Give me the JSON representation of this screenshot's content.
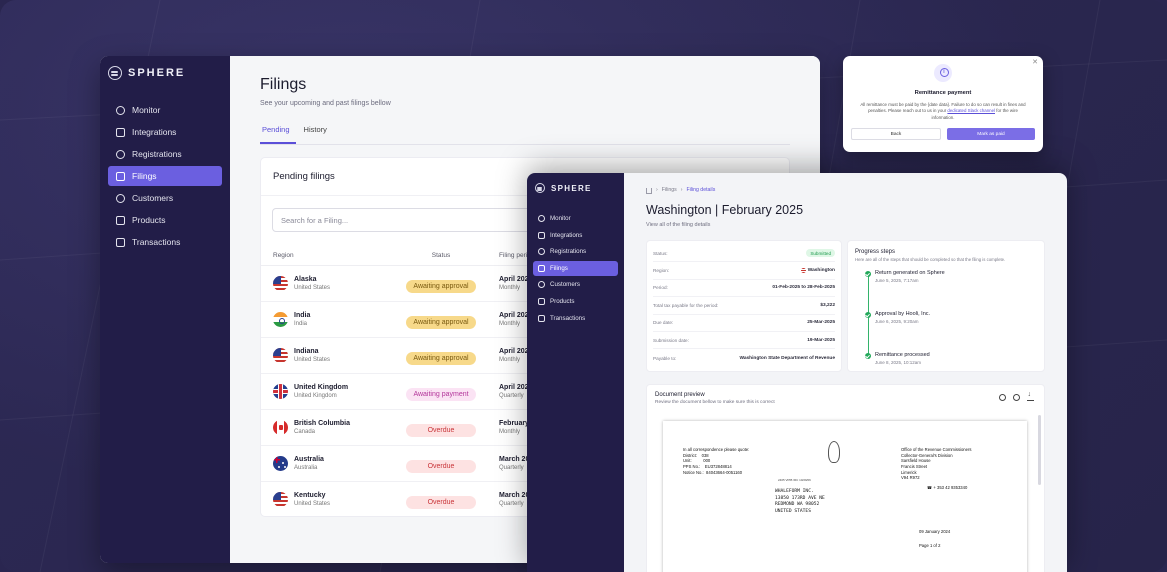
{
  "brand": "SPHERE",
  "nav": [
    {
      "label": "Monitor",
      "icon": "globe-icon"
    },
    {
      "label": "Integrations",
      "icon": "grid-icon"
    },
    {
      "label": "Registrations",
      "icon": "pin-icon"
    },
    {
      "label": "Filings",
      "icon": "clipboard-icon",
      "active": true
    },
    {
      "label": "Customers",
      "icon": "users-icon"
    },
    {
      "label": "Products",
      "icon": "box-icon"
    },
    {
      "label": "Transactions",
      "icon": "cash-icon"
    }
  ],
  "filings_page": {
    "title": "Filings",
    "subtitle": "See your upcoming and past filings bellow",
    "tabs": [
      "Pending",
      "History"
    ],
    "card_title": "Pending filings",
    "search_placeholder": "Search for a Filing...",
    "columns": [
      "Region",
      "Status",
      "Filing period"
    ],
    "rows": [
      {
        "region": "Alaska",
        "country": "United States",
        "flag": "us",
        "status": "Awaiting approval",
        "period": "April 2025",
        "frequency": "Monthly"
      },
      {
        "region": "India",
        "country": "India",
        "flag": "in",
        "status": "Awaiting approval",
        "period": "April 2025",
        "frequency": "Monthly"
      },
      {
        "region": "Indiana",
        "country": "United States",
        "flag": "us",
        "status": "Awaiting approval",
        "period": "April 2025",
        "frequency": "Monthly"
      },
      {
        "region": "United Kingdom",
        "country": "United Kingdom",
        "flag": "uk",
        "status": "Awaiting payment",
        "period": "April 2025",
        "frequency": "Quarterly"
      },
      {
        "region": "British Columbia",
        "country": "Canada",
        "flag": "ca",
        "status": "Overdue",
        "period": "February 20",
        "frequency": "Monthly"
      },
      {
        "region": "Australia",
        "country": "Australia",
        "flag": "au",
        "status": "Overdue",
        "period": "March 2025",
        "frequency": "Quarterly"
      },
      {
        "region": "Kentucky",
        "country": "United States",
        "flag": "us",
        "status": "Overdue",
        "period": "March 2025",
        "frequency": "Quarterly"
      }
    ]
  },
  "status_colors": {
    "Awaiting approval": {
      "bg": "#f7d98a",
      "fg": "#7a5a10"
    },
    "Awaiting payment": {
      "bg": "#fbe3f4",
      "fg": "#b3359a"
    },
    "Overdue": {
      "bg": "#fde2e2",
      "fg": "#c9363a"
    }
  },
  "detail_page": {
    "breadcrumb": [
      "Filings",
      "Filing details"
    ],
    "title": "Washington | February 2025",
    "subtitle": "View all of the filing details",
    "details": [
      {
        "label": "Status:",
        "value": "Submitted",
        "badge": true
      },
      {
        "label": "Region:",
        "value": "Washington",
        "flag": true
      },
      {
        "label": "Period:",
        "value": "01-Feb-2025 to 28-Feb-2025"
      },
      {
        "label": "Total tax payable for the period:",
        "value": "$3,222"
      },
      {
        "label": "Due date:",
        "value": "25-Mar-2025"
      },
      {
        "label": "Submission date:",
        "value": "19-Mar-2025"
      },
      {
        "label": "Payable to:",
        "value": "Washington State Department of Revenue"
      }
    ],
    "progress_title": "Progress steps",
    "progress_sub": "Here are all of the steps that should be completed so that the filing is complete.",
    "steps": [
      {
        "name": "Return generated on Sphere",
        "date": "June 5, 2025, 7:17am"
      },
      {
        "name": "Approval by Hooli, Inc.",
        "date": "June 6, 2025, 9:20am"
      },
      {
        "name": "Remittance processed",
        "date": "June 8, 2025, 10:12am"
      }
    ],
    "doc_title": "Document preview",
    "doc_sub": "Review the document bellow to make sure this is correct",
    "doc": {
      "left_block": [
        "In all correspondence please quote:",
        "District:    038",
        "Unit:          000",
        "PPS No.:    EU372848814",
        "Notice No.:  84043664-0051160"
      ],
      "small_caps": "2405 VPIB /RC 10/29/06",
      "address": [
        "WHALEFORM INC.",
        "13850 173RD AVE NE",
        "REDMOND WA 98052",
        "UNITED STATES"
      ],
      "office": [
        "Office of the Revenue Commissioners",
        "Collector-General's Division",
        "Sarsfield House",
        "Francis Street",
        "Limerick",
        "V94 R972"
      ],
      "phone": "+ 353 42 9353340",
      "date": "09 January 2024",
      "page": "Page 1 of 2"
    }
  },
  "modal": {
    "title": "Remittance payment",
    "text_before": "All remittance must be paid by the {date data}. Failure to do so can result in fines and penalties. Please reach out to us in your ",
    "link": "dedicated Slack channel",
    "text_after": " for the wire information.",
    "back_label": "Back",
    "paid_label": "Mark as paid"
  }
}
